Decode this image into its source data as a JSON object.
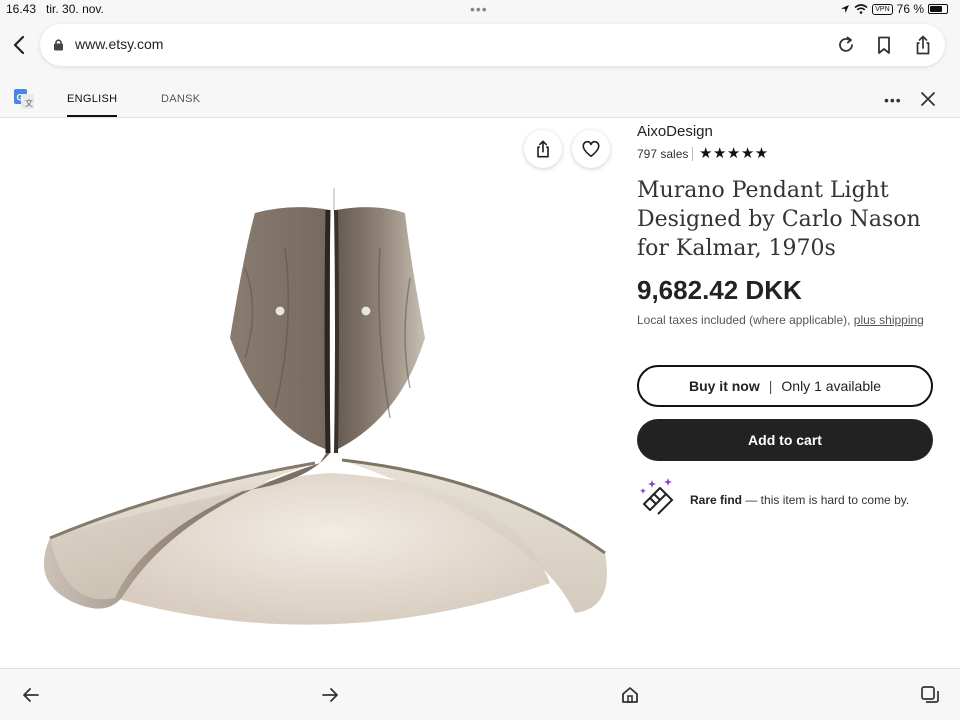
{
  "status_bar": {
    "time": "16.43",
    "date": "tir. 30. nov.",
    "vpn": "VPN",
    "battery": "76 %",
    "battery_level": 0.76
  },
  "browser": {
    "url": "www.etsy.com"
  },
  "translate": {
    "tab_english": "ENGLISH",
    "tab_danish": "DANSK"
  },
  "product": {
    "shop_name": "AixoDesign",
    "sales": "797 sales",
    "stars": "★★★★★",
    "title": "Murano Pendant Light Designed by Carlo Nason for Kalmar, 1970s",
    "price": "9,682.42 DKK",
    "tax_text": "Local taxes included (where applicable), ",
    "tax_link": "plus shipping",
    "buy_now_label": "Buy it now",
    "availability": "Only 1 available",
    "add_to_cart_label": "Add to cart",
    "rare_find_bold": "Rare find",
    "rare_find_text": " — this item is hard to come by."
  },
  "colors": {
    "button_dark": "#222222",
    "page_bg": "#f7f7f7"
  }
}
